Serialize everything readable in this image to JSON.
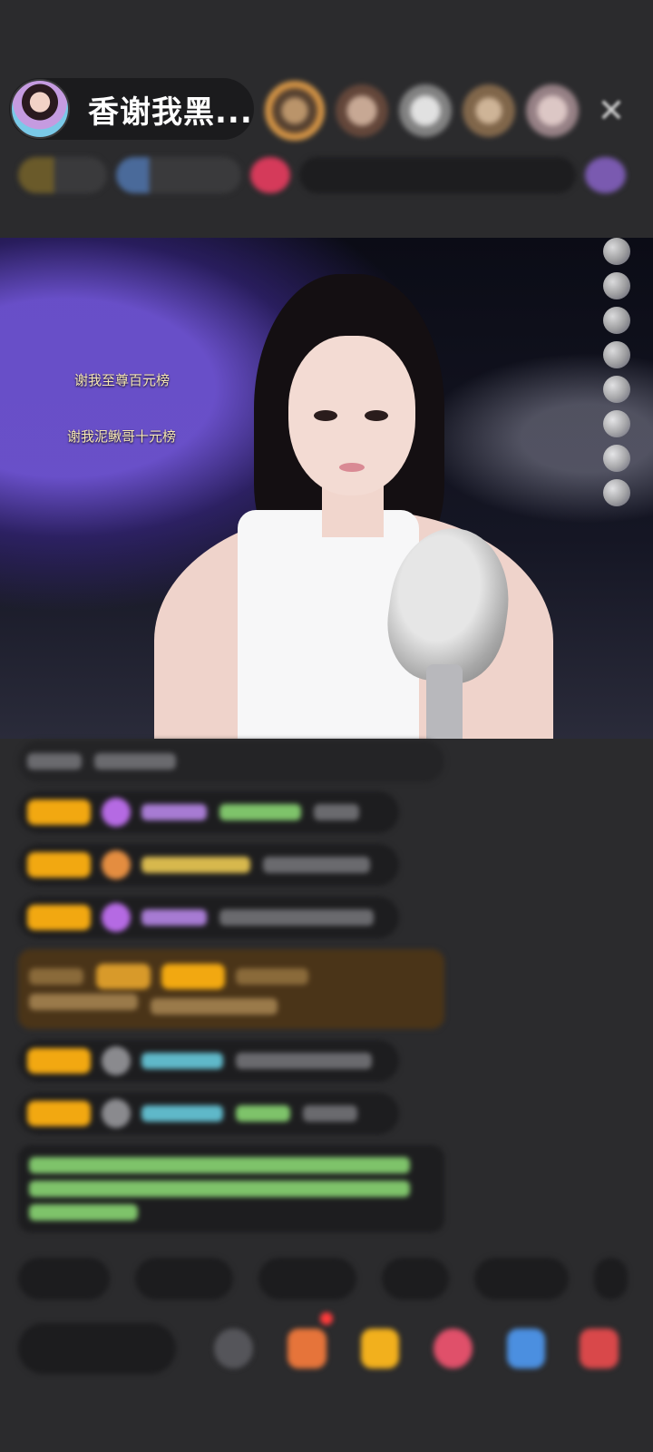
{
  "header": {
    "host_name": "香谢我黑...",
    "close_icon": "close-icon"
  },
  "video": {
    "captions": [
      "谢我至尊百元榜",
      "谢我泥鳅哥十元榜"
    ]
  },
  "colors": {
    "background": "#2b2b2d",
    "badge_gold": "#f2a811",
    "gift_message_bg": "#4a3418"
  }
}
